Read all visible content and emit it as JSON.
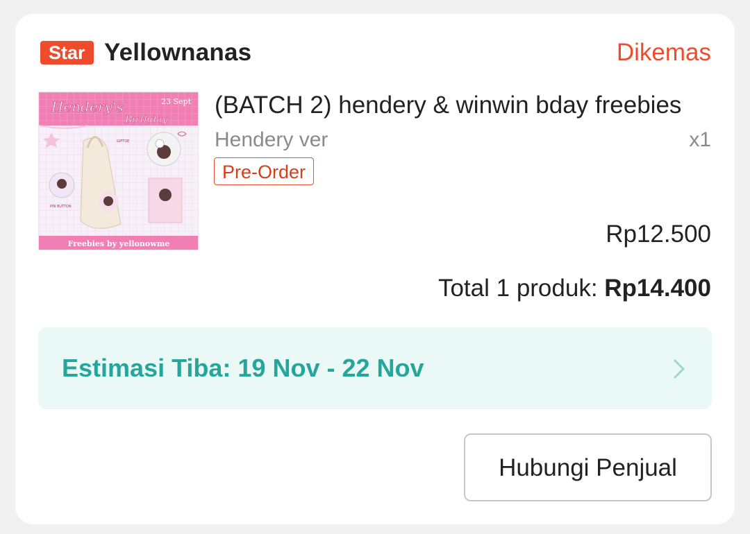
{
  "shop": {
    "badge": "Star",
    "name": "Yellownanas",
    "status": "Dikemas"
  },
  "product": {
    "title": "(BATCH 2) hendery & winwin bday freebies",
    "variant": "Hendery ver",
    "quantity": "x1",
    "tag": "Pre-Order",
    "price": "Rp12.500",
    "image": {
      "title_line1": "Hendery's",
      "title_line2": "Birthday",
      "date": "23 Sept",
      "footer": "Freebies by yellonowme"
    }
  },
  "summary": {
    "label": "Total 1 produk: ",
    "amount": "Rp14.400"
  },
  "delivery": {
    "estimate": "Estimasi Tiba: 19 Nov - 22 Nov"
  },
  "actions": {
    "contact_seller": "Hubungi Penjual"
  },
  "colors": {
    "accent": "#ee4d2d",
    "eta_text": "#26a69a",
    "eta_bg": "#eaf8f6"
  }
}
